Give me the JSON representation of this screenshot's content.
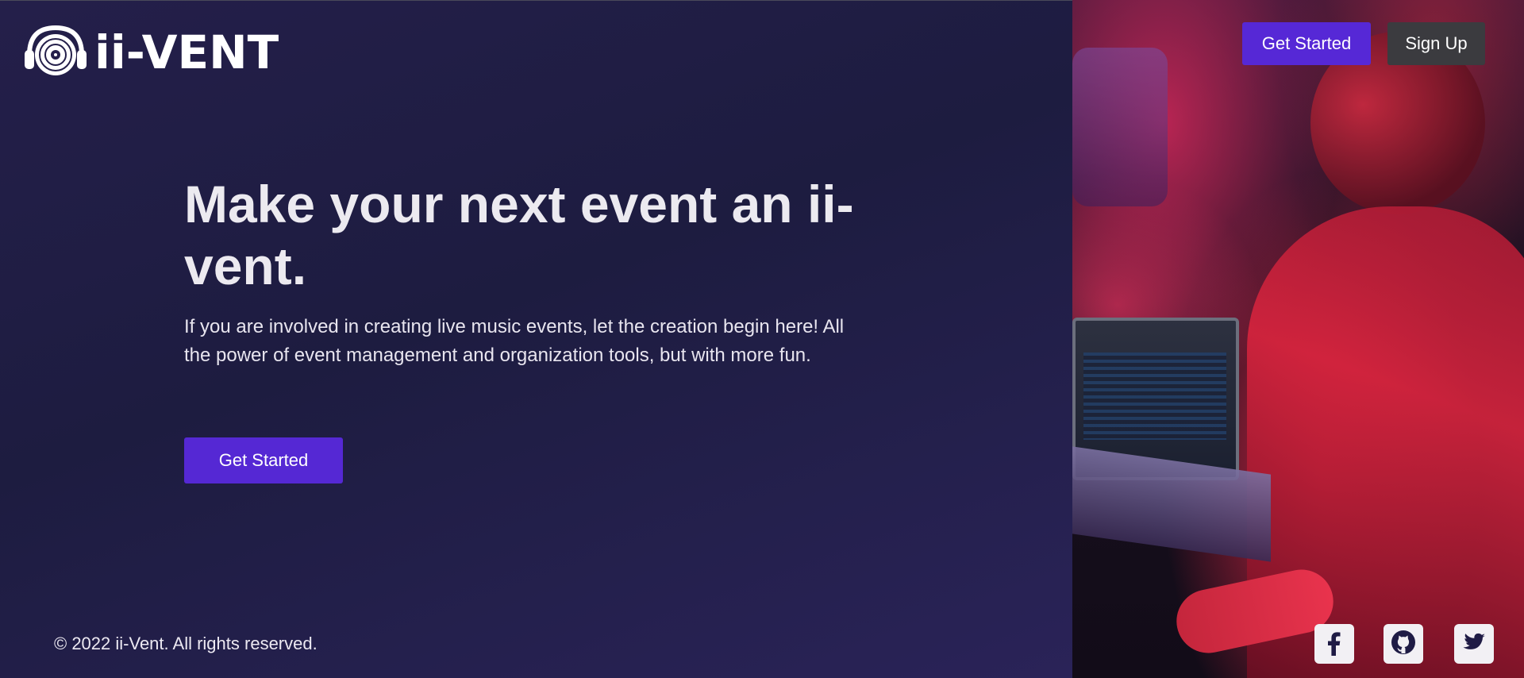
{
  "brand": {
    "name": "ii-VENT",
    "logo_icon": "vinyl-headphones-icon"
  },
  "nav": {
    "get_started_label": "Get Started",
    "sign_up_label": "Sign Up"
  },
  "hero": {
    "title": "Make your next event an ii-vent.",
    "description": "If you are involved in creating live music events, let the creation begin here! All the power of event management and organization tools, but with more fun.",
    "cta_label": "Get Started"
  },
  "footer": {
    "copyright": "© 2022 ii-Vent. All rights reserved.",
    "social_icons": [
      "facebook-icon",
      "github-icon",
      "twitter-icon"
    ]
  },
  "colors": {
    "primary": "#5528d4",
    "secondary_button": "#3b3b3f",
    "background": "#1f1b45",
    "text": "#eceaf0"
  }
}
